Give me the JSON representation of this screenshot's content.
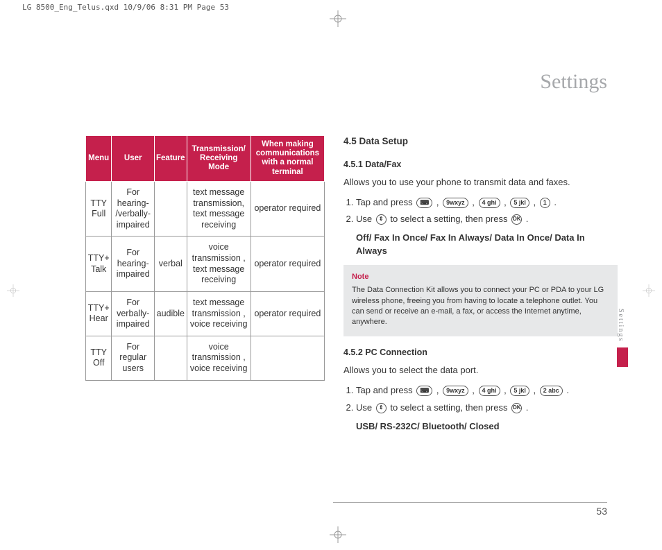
{
  "header_strip": "LG 8500_Eng_Telus.qxd  10/9/06  8:31 PM  Page 53",
  "title": "Settings",
  "side_tab": "Settings",
  "page_number": "53",
  "table": {
    "headers": [
      "Menu",
      "User",
      "Feature",
      "Transmission/ Receiving Mode",
      "When making communications with a normal terminal"
    ],
    "rows": [
      {
        "menu": "TTY Full",
        "user": "For hearing- /verbally- impaired",
        "feature": "",
        "mode": "text message transmission, text message receiving",
        "comm": "operator required"
      },
      {
        "menu": "TTY+ Talk",
        "user": "For hearing- impaired",
        "feature": "verbal",
        "mode": "voice transmission , text message receiving",
        "comm": "operator required"
      },
      {
        "menu": "TTY+ Hear",
        "user": "For verbally- impaired",
        "feature": "audible",
        "mode": "text message transmission , voice receiving",
        "comm": "operator required"
      },
      {
        "menu": "TTY Off",
        "user": "For regular users",
        "feature": "",
        "mode": "voice transmission , voice receiving",
        "comm": ""
      }
    ]
  },
  "right": {
    "h3": "4.5 Data Setup",
    "s1": {
      "h4": "4.5.1 Data/Fax",
      "intro": "Allows you to use your phone to transmit data and faxes.",
      "step1_a": "Tap and press ",
      "keys1": [
        "⌨",
        "9wxyz",
        "4 ghi",
        "5 jkl",
        "1"
      ],
      "step1_b": ".",
      "step2_a": "Use ",
      "nav_key": "⇕",
      "step2_b": " to select a setting, then press ",
      "ok_key": "OK",
      "step2_c": ".",
      "options": "Off/ Fax In Once/ Fax In Always/ Data In Once/ Data In Always",
      "note_label": "Note",
      "note_text": "The Data Connection Kit allows you to connect your PC or PDA to your LG wireless phone, freeing you from having to locate a telephone outlet. You can send or receive an e-mail, a fax, or access the Internet anytime, anywhere."
    },
    "s2": {
      "h4": "4.5.2 PC Connection",
      "intro": "Allows you to select the data port.",
      "step1_a": "Tap and press ",
      "keys1": [
        "⌨",
        "9wxyz",
        "4 ghi",
        "5 jkl",
        "2 abc"
      ],
      "step1_b": ".",
      "step2_a": "Use ",
      "nav_key": "⇕",
      "step2_b": " to select a setting, then press ",
      "ok_key": "OK",
      "step2_c": ".",
      "options": "USB/ RS-232C/ Bluetooth/ Closed"
    }
  }
}
